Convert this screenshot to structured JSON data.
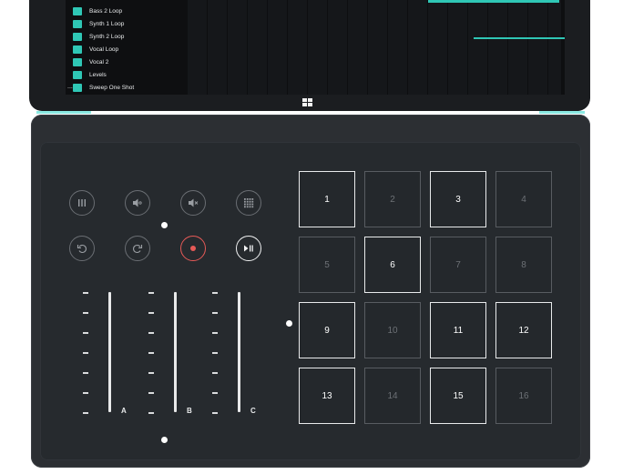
{
  "tracks": [
    {
      "num": "",
      "name": "Bass 2 Loop",
      "color": "#2fc7b5"
    },
    {
      "num": "",
      "name": "Synth 1 Loop",
      "color": "#2fc7b5"
    },
    {
      "num": "",
      "name": "Synth 2 Loop",
      "color": "#2fc7b5"
    },
    {
      "num": "",
      "name": "Vocal Loop",
      "color": "#2fc7b5"
    },
    {
      "num": "",
      "name": "Vocal 2",
      "color": "#2fc7b5"
    },
    {
      "num": "",
      "name": "Levels",
      "color": "#2fc7b5"
    },
    {
      "num": "",
      "name": "Sweep One Shot",
      "color": "#2fc7b5"
    }
  ],
  "more_indicator": "...",
  "controls": [
    {
      "icon": "loops-icon",
      "name": "loops-button"
    },
    {
      "icon": "volume-icon",
      "name": "volume-button"
    },
    {
      "icon": "mute-icon",
      "name": "mute-button"
    },
    {
      "icon": "pad-grid-icon",
      "name": "pad-grid-button"
    },
    {
      "icon": "undo-icon",
      "name": "undo-button"
    },
    {
      "icon": "redo-icon",
      "name": "redo-button"
    },
    {
      "icon": "record-icon",
      "name": "record-button"
    },
    {
      "icon": "play-pause-icon",
      "name": "play-pause-button"
    }
  ],
  "faders": [
    {
      "label": "A"
    },
    {
      "label": "B"
    },
    {
      "label": "C"
    }
  ],
  "pads": [
    {
      "label": "1",
      "active": true
    },
    {
      "label": "2",
      "active": false
    },
    {
      "label": "3",
      "active": true
    },
    {
      "label": "4",
      "active": false
    },
    {
      "label": "5",
      "active": false
    },
    {
      "label": "6",
      "active": true
    },
    {
      "label": "7",
      "active": false
    },
    {
      "label": "8",
      "active": false
    },
    {
      "label": "9",
      "active": true
    },
    {
      "label": "10",
      "active": false
    },
    {
      "label": "11",
      "active": true
    },
    {
      "label": "12",
      "active": true
    },
    {
      "label": "13",
      "active": true
    },
    {
      "label": "14",
      "active": false
    },
    {
      "label": "15",
      "active": true
    },
    {
      "label": "16",
      "active": false
    }
  ],
  "colors": {
    "accent": "#59e0d6",
    "record": "#e65a57",
    "pad_active": "#e9ebec",
    "pad_inactive": "#585c61"
  }
}
